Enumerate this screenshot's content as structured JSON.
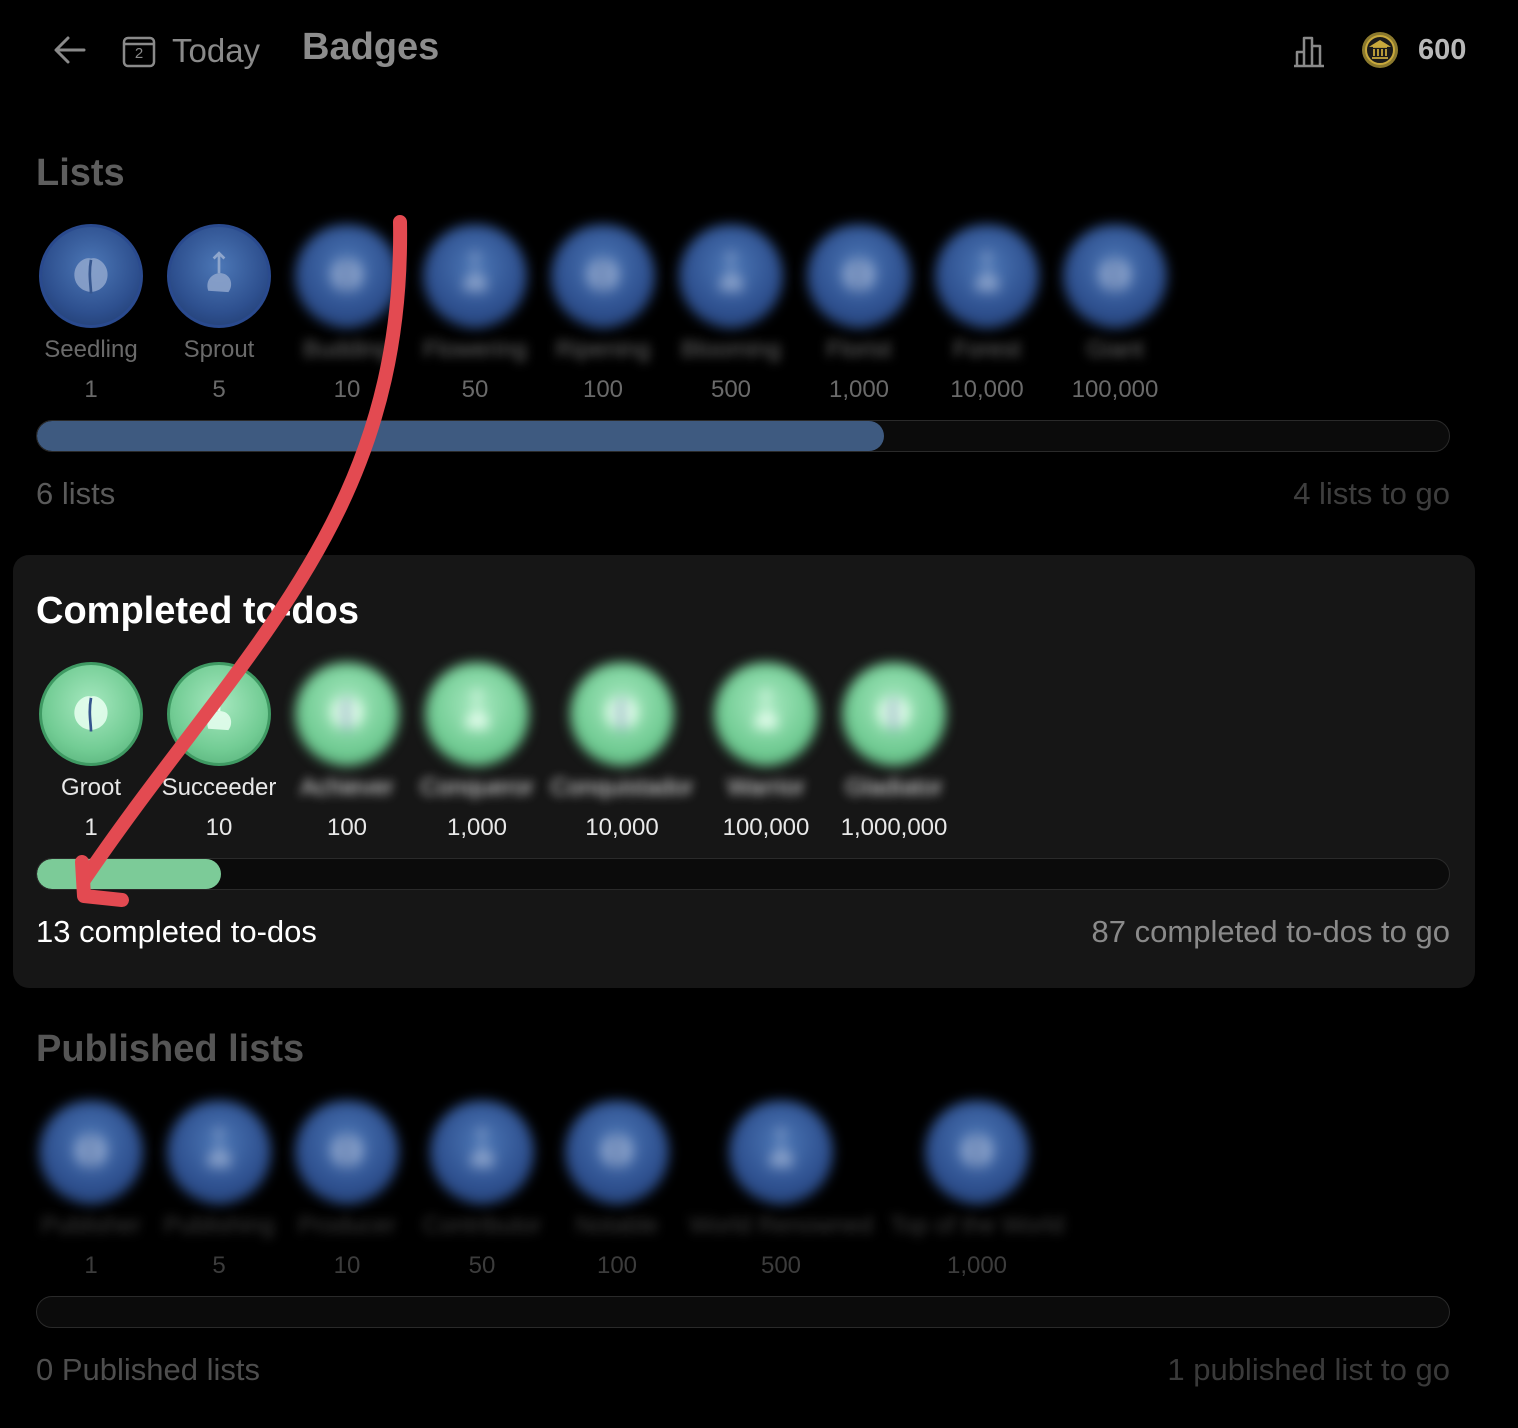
{
  "header": {
    "today_label": "Today",
    "calendar_day": "2",
    "title": "Badges",
    "coin_count": "600",
    "icons": [
      "back-arrow-icon",
      "calendar-icon",
      "stats-chart-icon",
      "coin-icon"
    ]
  },
  "sections": {
    "lists": {
      "title": "Lists",
      "badges": [
        {
          "name": "Seedling",
          "threshold": "1",
          "earned": true
        },
        {
          "name": "Sprout",
          "threshold": "5",
          "earned": true
        },
        {
          "name": "Budding",
          "threshold": "10",
          "earned": false
        },
        {
          "name": "Flowering",
          "threshold": "50",
          "earned": false
        },
        {
          "name": "Ripening",
          "threshold": "100",
          "earned": false
        },
        {
          "name": "Blooming",
          "threshold": "500",
          "earned": false
        },
        {
          "name": "Florist",
          "threshold": "1,000",
          "earned": false
        },
        {
          "name": "Forest",
          "threshold": "10,000",
          "earned": false
        },
        {
          "name": "Giant",
          "threshold": "100,000",
          "earned": false
        }
      ],
      "progress": 0.6,
      "progress_label": "6 lists",
      "remaining_label": "4 lists to go",
      "color": "#3e5a80"
    },
    "todos": {
      "title": "Completed to-dos",
      "badges": [
        {
          "name": "Groot",
          "threshold": "1",
          "earned": true
        },
        {
          "name": "Succeeder",
          "threshold": "10",
          "earned": true
        },
        {
          "name": "Achiever",
          "threshold": "100",
          "earned": false
        },
        {
          "name": "Conqueror",
          "threshold": "1,000",
          "earned": false
        },
        {
          "name": "Conquistador",
          "threshold": "10,000",
          "earned": false
        },
        {
          "name": "Warrior",
          "threshold": "100,000",
          "earned": false
        },
        {
          "name": "Gladiator",
          "threshold": "1,000,000",
          "earned": false
        }
      ],
      "progress": 0.13,
      "progress_label": "13 completed to-dos",
      "remaining_label": "87 completed to-dos to go",
      "color": "#7ccb98"
    },
    "published": {
      "title": "Published lists",
      "badges": [
        {
          "name": "Publisher",
          "threshold": "1",
          "earned": false
        },
        {
          "name": "Publishing",
          "threshold": "5",
          "earned": false
        },
        {
          "name": "Producer",
          "threshold": "10",
          "earned": false
        },
        {
          "name": "Contributor",
          "threshold": "50",
          "earned": false
        },
        {
          "name": "Notable",
          "threshold": "100",
          "earned": false
        },
        {
          "name": "World Renowned",
          "threshold": "500",
          "earned": false
        },
        {
          "name": "Top of the World",
          "threshold": "1,000",
          "earned": false
        }
      ],
      "progress": 0,
      "progress_label": "0 Published lists",
      "remaining_label": "1 published list to go"
    }
  },
  "annotation": {
    "type": "red-arrow",
    "color": "#e34a51"
  }
}
